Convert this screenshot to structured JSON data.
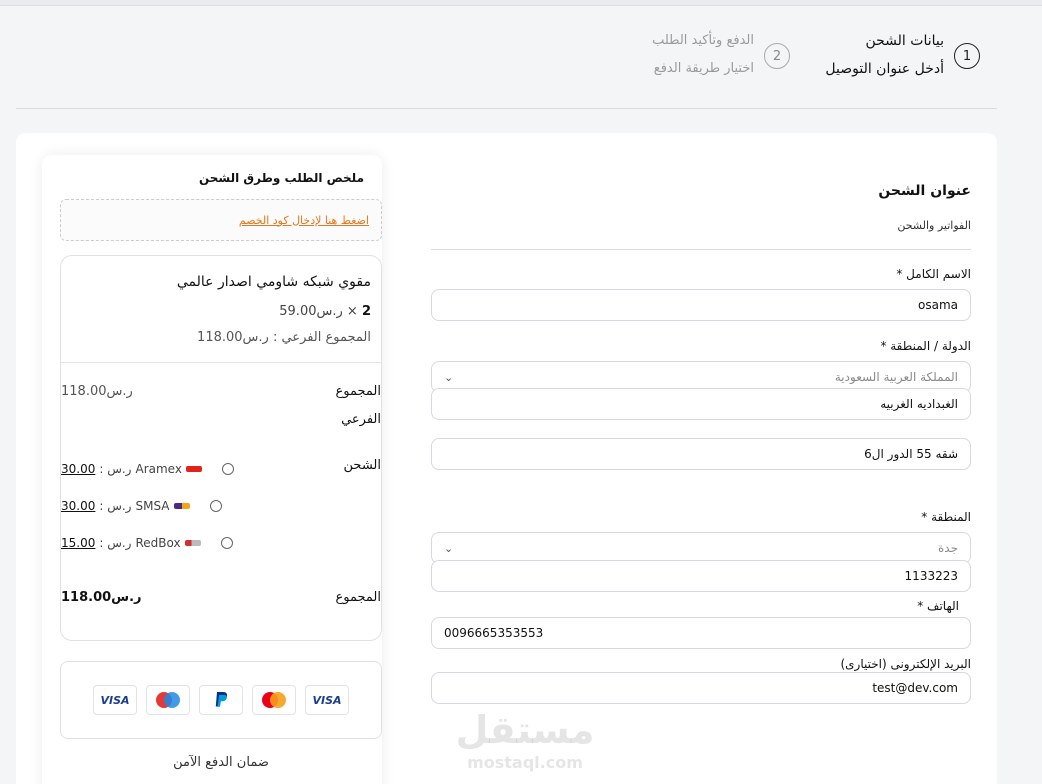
{
  "steps": [
    {
      "number": "1",
      "title": "بيانات الشحن",
      "subtitle": "أدخل عنوان التوصيل"
    },
    {
      "number": "2",
      "title": "الدفع وتأكيد الطلب",
      "subtitle": "اختيار طريقة الدفع"
    }
  ],
  "form": {
    "title": "عنوان الشحن",
    "subtitle": "الفواتير والشحن",
    "name_label": "الاسم الكامل *",
    "name_value": "osama",
    "country_label": "الدولة / المنطقة *",
    "country_value": "المملكة العربية السعودية",
    "district_value": "الغبداديه الغربيه",
    "address_value": "شقه 55 الدور ال6",
    "region_label": "المنطقة *",
    "region_value": "جدة",
    "postcode_value": "1133223",
    "phone_label": "الهاتف *",
    "phone_value": "0096665353553",
    "email_label": "البريد الإلكترونى (اختيارى)",
    "email_value": "test@dev.com"
  },
  "summary": {
    "title": "ملخص الطلب وطرق الشحن",
    "coupon_link": "اضغط هنا لإدخال كود الخصم",
    "item_name": "مقوي شبكه شاومي اصدار عالمي",
    "item_qty": "2",
    "item_qty_sep": "×",
    "item_price": "ر.س59.00",
    "item_subtotal": "المجموع الفرعي : ر.س118.00",
    "subtotal_label_1": "المجموع",
    "subtotal_label_2": "الفرعي",
    "subtotal_value": "ر.س118.00",
    "shipping_label": "الشحن",
    "shipping_options": [
      {
        "name": "Aramex",
        "price_prefix": ": ر.س",
        "price": "30.00"
      },
      {
        "name": "SMSA",
        "price_prefix": ": ر.س",
        "price": "30.00"
      },
      {
        "name": "RedBox",
        "price_prefix": ": ر.س",
        "price": "15.00"
      }
    ],
    "total_label": "المجموع",
    "total_value": "ر.س118.00",
    "payment_cards": [
      "VISA",
      "maestro",
      "PayPal",
      "mastercard",
      "VISA"
    ],
    "secure_text": "ضمان الدفع الآمن"
  },
  "watermark": {
    "ar": "مستقل",
    "en": "mostaql.com"
  },
  "colors": {
    "accent": "#e8771c",
    "border": "#d6d9dd",
    "visa": "#1a3d8f",
    "paypal": "#003087",
    "mastercard_red": "#eb001b",
    "mastercard_yellow": "#f79e1b"
  },
  "icons": {
    "select_chevron": "chevron-down-icon",
    "radio": "radio-icon"
  }
}
